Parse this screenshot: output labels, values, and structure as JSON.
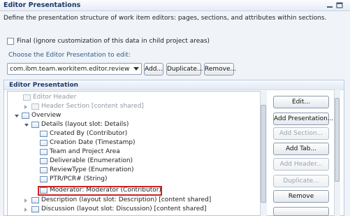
{
  "header": {
    "title": "Editor Presentations"
  },
  "description": "Define the presentation structure of work item editors: pages, sections, and attributes within sections.",
  "final_checkbox": {
    "label": "Final (ignore customization of this data in child project areas)",
    "checked": false
  },
  "choose_label": "Choose the Editor Presentation to edit:",
  "editor_select": {
    "value": "com.ibm.team.workitem.editor.review"
  },
  "top_buttons": {
    "add": "Add...",
    "duplicate": "Duplicate...",
    "remove": "Remove..."
  },
  "section": {
    "title": "Editor Presentation"
  },
  "tree": [
    {
      "label": "Editor Header",
      "muted": true
    },
    {
      "label": "Header Section [content shared]",
      "muted": true
    },
    {
      "label": "Overview",
      "muted": false
    },
    {
      "label": "Details (layout slot: Details)",
      "muted": false
    },
    {
      "label": "Created By (Contributor)",
      "muted": false
    },
    {
      "label": "Creation Date (Timestamp)",
      "muted": false
    },
    {
      "label": "Team and Project Area",
      "muted": false
    },
    {
      "label": "Deliverable (Enumeration)",
      "muted": false
    },
    {
      "label": "ReviewType (Enumeration)",
      "muted": false
    },
    {
      "label": "PTR/PCR# (String)",
      "muted": false
    },
    {
      "label": "Moderator: Moderator (Contributor)",
      "muted": false,
      "selected": true
    },
    {
      "label": "Description (layout slot: Description) [content shared]",
      "muted": false
    },
    {
      "label": "Discussion (layout slot: Discussion) [content shared]",
      "muted": false
    }
  ],
  "side_buttons": {
    "edit": "Edit...",
    "add_presentation": "Add Presentation...",
    "add_section": "Add Section...",
    "add_tab": "Add Tab...",
    "add_header": "Add Header...",
    "duplicate": "Duplicate...",
    "remove": "Remove"
  }
}
